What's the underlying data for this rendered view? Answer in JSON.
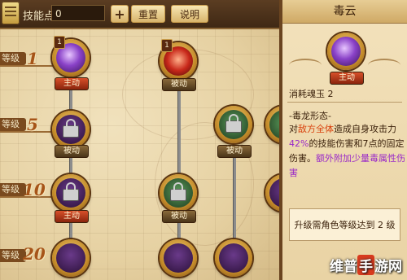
{
  "toolbar": {
    "skill_points_label": "技能点:",
    "skill_points_value": "0",
    "plus_label": "+",
    "reset_label": "重置",
    "help_label": "说明"
  },
  "tree": {
    "level_word": "等级",
    "levels": [
      "1",
      "5",
      "10",
      "20"
    ],
    "nodes": [
      {
        "name": "毒云",
        "badge": "1",
        "type": "主动",
        "locked": false,
        "color": "purple"
      },
      {
        "name": "skill-2",
        "badge": "1",
        "type": "被动",
        "locked": false,
        "color": "red"
      },
      {
        "name": "skill-3",
        "badge": "",
        "type": "被动",
        "locked": true,
        "color": "dark"
      },
      {
        "name": "skill-4",
        "badge": "",
        "type": "被动",
        "locked": true,
        "color": "green"
      },
      {
        "name": "skill-5",
        "badge": "",
        "type": "主动",
        "locked": true,
        "color": "dark"
      },
      {
        "name": "skill-6",
        "badge": "",
        "type": "被动",
        "locked": true,
        "color": "green"
      }
    ]
  },
  "detail": {
    "title": "毒云",
    "type": "主动",
    "cost": "消耗魂玉 2",
    "form": "-毒龙形态-",
    "line1_a": "对",
    "line1_b": "敌方全体",
    "line1_c": "造成自身攻击力",
    "line2_a": "42%",
    "line2_b": "的技能伤害和7点的固定",
    "line3_a": "伤害。",
    "line3_b": "额外附加少量毒属性伤",
    "line4": "害",
    "requirement": "升级需角色等级达到 2 级"
  },
  "watermark": {
    "left": "维普",
    "hand": "手",
    "right": "游网"
  }
}
